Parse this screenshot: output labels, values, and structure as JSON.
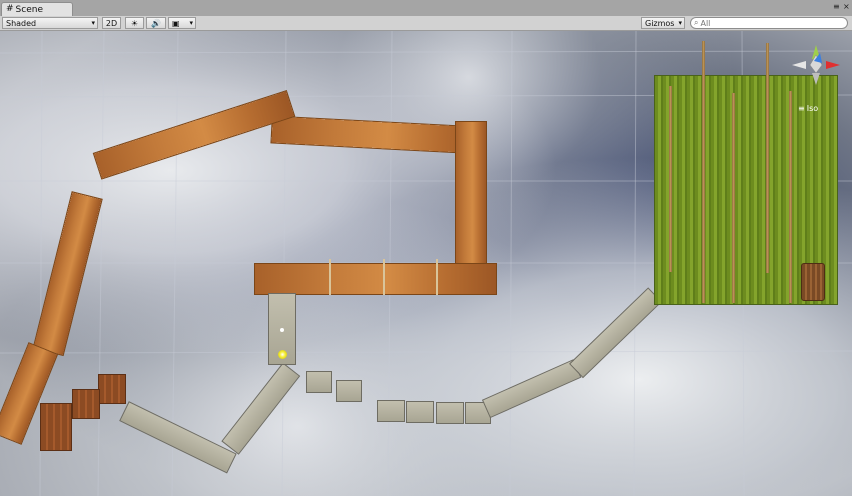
{
  "tab": {
    "icon": "scene-grid-icon",
    "label": "Scene"
  },
  "window_controls": {
    "menu": "≡",
    "close": "×"
  },
  "toolbar": {
    "draw_mode": "Shaded",
    "toggle_2d": "2D",
    "lighting_icon": "sun-icon",
    "audio_icon": "speaker-icon",
    "effects_icon": "image-icon",
    "gizmos": "Gizmos",
    "search_placeholder": "All"
  },
  "gizmo": {
    "projection": "Iso",
    "accent_x": "#e03030",
    "accent_y": "#40c040",
    "accent_z": "#3060e0"
  }
}
